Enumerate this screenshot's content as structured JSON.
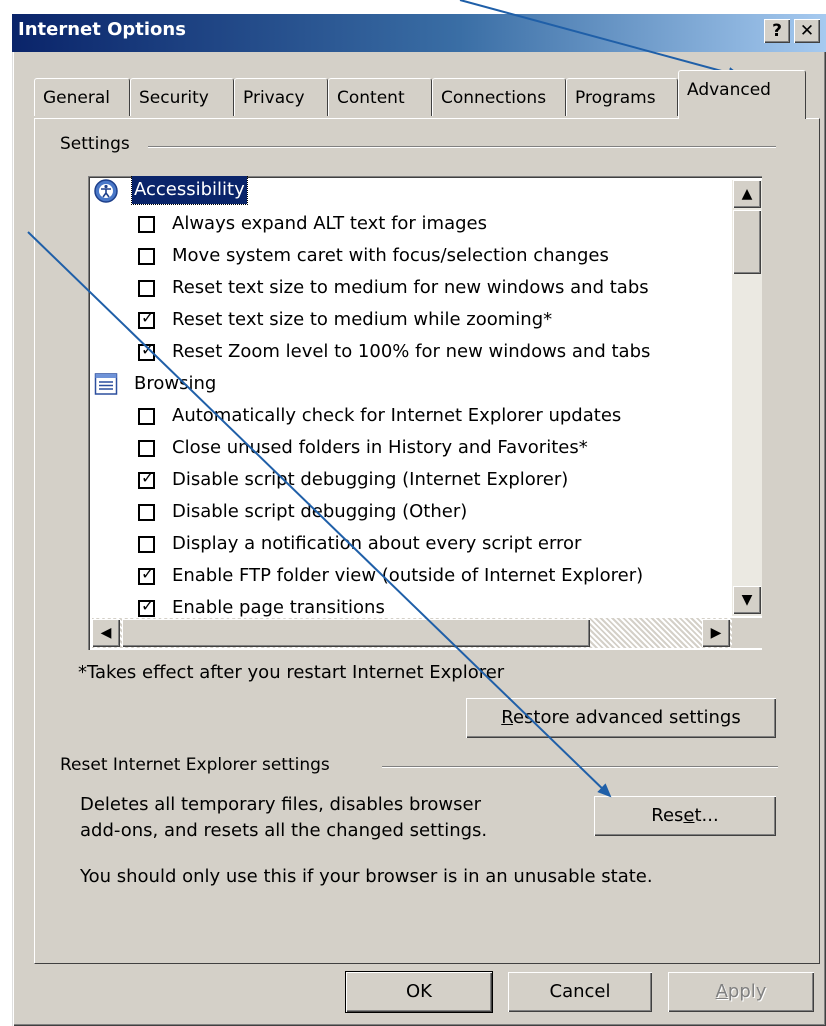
{
  "window": {
    "title": "Internet Options",
    "help_label": "?",
    "close_label": "✕"
  },
  "tabs": [
    "General",
    "Security",
    "Privacy",
    "Content",
    "Connections",
    "Programs",
    "Advanced"
  ],
  "active_tab": "Advanced",
  "settings": {
    "group_label": "Settings",
    "categories": [
      {
        "label": "Accessibility",
        "icon": "accessibility-icon",
        "selected": true,
        "items": [
          {
            "label": "Always expand ALT text for images",
            "checked": false
          },
          {
            "label": "Move system caret with focus/selection changes",
            "checked": false
          },
          {
            "label": "Reset text size to medium for new windows and tabs",
            "checked": false
          },
          {
            "label": "Reset text size to medium while zooming*",
            "checked": true
          },
          {
            "label": "Reset Zoom level to 100% for new windows and tabs",
            "checked": true
          }
        ]
      },
      {
        "label": "Browsing",
        "icon": "browsing-icon",
        "selected": false,
        "items": [
          {
            "label": "Automatically check for Internet Explorer updates",
            "checked": false
          },
          {
            "label": "Close unused folders in History and Favorites*",
            "checked": false
          },
          {
            "label": "Disable script debugging (Internet Explorer)",
            "checked": true
          },
          {
            "label": "Disable script debugging (Other)",
            "checked": false
          },
          {
            "label": "Display a notification about every script error",
            "checked": false
          },
          {
            "label": "Enable FTP folder view (outside of Internet Explorer)",
            "checked": true
          },
          {
            "label": "Enable page transitions",
            "checked": true
          }
        ]
      }
    ],
    "footnote": "*Takes effect after you restart Internet Explorer",
    "restore_button": "Restore advanced settings"
  },
  "reset": {
    "group_label": "Reset Internet Explorer settings",
    "description_line1": "Deletes all temporary files, disables browser",
    "description_line2": "add-ons, and resets all the changed settings.",
    "warning": "You should only use this if your browser is in an unusable state.",
    "button": "Reset..."
  },
  "footer": {
    "ok": "OK",
    "cancel": "Cancel",
    "apply": "Apply"
  },
  "annotation_color": "#1f5fa8"
}
